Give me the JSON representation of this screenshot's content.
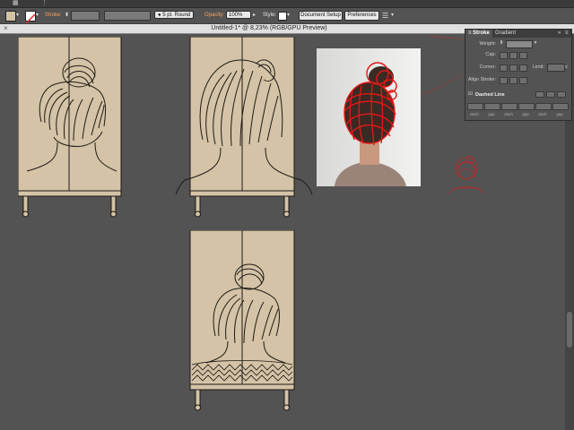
{
  "control_bar": {
    "stroke_label": "Stroke",
    "brush_value": "5 pt. Round",
    "opacity_label": "Opacity:",
    "opacity_value": "100%",
    "style_label": "Style:",
    "document_setup": "Document Setup",
    "preferences": "Preferences"
  },
  "document": {
    "title": "Untitled-1* @ 8,23% (RGB/GPU Preview)"
  },
  "stroke_panel": {
    "tab_stroke": "Stroke",
    "tab_gradient": "Gradient",
    "weight_label": "Weight:",
    "cap_label": "Cap:",
    "corner_label": "Corner:",
    "limit_label": "Limit:",
    "limit_unit": "x",
    "align_label": "Align Stroke:",
    "dashed_label": "Dashed Line",
    "dash_labels": [
      "dash",
      "gap",
      "dash",
      "gap",
      "dash",
      "gap"
    ]
  },
  "colors": {
    "canvas": "#535353",
    "artboard": "#d4c3a6",
    "line_art": "#1e1a15",
    "selection_red": "#d6262a"
  }
}
